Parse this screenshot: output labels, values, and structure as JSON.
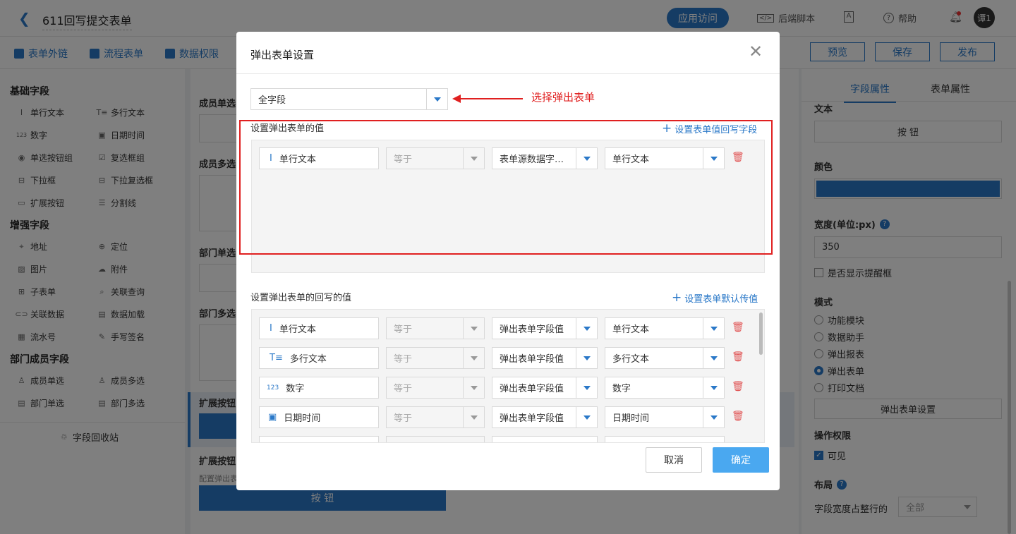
{
  "header": {
    "title": "611回写提交表单",
    "app_access": "应用访问",
    "backend_script": "后端脚本",
    "help": "帮助",
    "avatar": "谭1"
  },
  "toolbar": {
    "items": [
      "表单外链",
      "流程表单",
      "数据权限"
    ],
    "buttons": [
      "预览",
      "保存",
      "发布"
    ]
  },
  "left_panel": {
    "sections": [
      {
        "title": "基础字段",
        "fields": [
          "单行文本",
          "多行文本",
          "数字",
          "日期时间",
          "单选按钮组",
          "复选框组",
          "下拉框",
          "下拉复选框",
          "扩展按钮",
          "分割线"
        ]
      },
      {
        "title": "增强字段",
        "fields": [
          "地址",
          "定位",
          "图片",
          "附件",
          "子表单",
          "关联查询",
          "关联数据",
          "数据加载",
          "流水号",
          "手写签名"
        ]
      },
      {
        "title": "部门成员字段",
        "fields": [
          "成员单选",
          "成员多选",
          "部门单选",
          "部门多选"
        ]
      }
    ],
    "recycle": "字段回收站"
  },
  "center": {
    "labels": [
      "成员单选",
      "成员多选",
      "部门单选",
      "部门多选",
      "扩展按钮",
      "扩展按钮"
    ],
    "config_text": "配置弹出表",
    "button_text": "按 钮"
  },
  "right_panel": {
    "tabs": [
      "字段属性",
      "表单属性"
    ],
    "text_label": "文本",
    "text_value": "按 钮",
    "color_label": "颜色",
    "color_value": "#2a78c8",
    "width_label": "宽度(单位:px)",
    "width_value": "350",
    "show_tip": "是否显示提醒框",
    "mode_label": "模式",
    "modes": [
      "功能模块",
      "数据助手",
      "弹出报表",
      "弹出表单",
      "打印文档"
    ],
    "selected_mode": "弹出表单",
    "popup_settings_btn": "弹出表单设置",
    "permission_label": "操作权限",
    "visible": "可见",
    "layout_label": "布局",
    "layout_width_label": "字段宽度占整行的",
    "layout_width_value": "全部"
  },
  "modal": {
    "title": "弹出表单设置",
    "form_select": "全字段",
    "annotation": "选择弹出表单",
    "section1_title": "设置弹出表单的值",
    "section1_link": "设置表单值回写字段",
    "section1_rows": [
      {
        "field": "单行文本",
        "op": "等于",
        "source": "表单源数据字…",
        "target": "单行文本"
      }
    ],
    "section2_title": "设置弹出表单的回写的值",
    "section2_link": "设置表单默认传值",
    "section2_rows": [
      {
        "field": "单行文本",
        "op": "等于",
        "source": "弹出表单字段值",
        "target": "单行文本"
      },
      {
        "field": "多行文本",
        "op": "等于",
        "source": "弹出表单字段值",
        "target": "多行文本"
      },
      {
        "field": "数字",
        "op": "等于",
        "source": "弹出表单字段值",
        "target": "数字"
      },
      {
        "field": "日期时间",
        "op": "等于",
        "source": "弹出表单字段值",
        "target": "日期时间"
      }
    ],
    "cancel": "取消",
    "confirm": "确定"
  }
}
